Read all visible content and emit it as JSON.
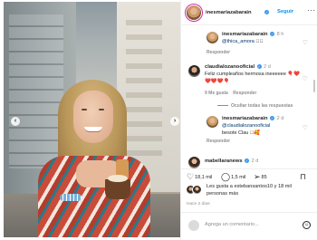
{
  "header": {
    "username": "inesmariazabarain",
    "follow_label": "Seguir",
    "more_label": "···"
  },
  "comments": [
    {
      "username": "inesmariazabarain",
      "time": "8 h",
      "mention": "@thica_amora",
      "emojis": "🏽🏽",
      "reply_label": "Responder"
    },
    {
      "username": "claudialozanooficial",
      "time": "2 d",
      "text": "Feliz cumpleaños hermosa ineeeeee",
      "emojis": "🎈❤️❤️❤️❤️🎈",
      "likes_label": "9 Me gusta",
      "reply_label": "Responder"
    },
    {
      "username": "inesmariazabarain",
      "time": "2 d",
      "mention": "@claudialozanooficial",
      "text": "besote Clau",
      "emojis": "🏽🥰",
      "reply_label": "Responder"
    },
    {
      "username": "mabellaranews",
      "time": "2 d"
    }
  ],
  "hide_replies_label": "Ocultar todas las respuestas",
  "actions": {
    "likes_count": "18,1 mil",
    "comments_count": "1,5 mil",
    "shares_count": "85"
  },
  "likes": {
    "text": "Les gusta a estebansantos10 y 18 mil personas más"
  },
  "posted_ago": "Hace 2 días",
  "add_comment": {
    "placeholder": "Agrega un comentario..."
  },
  "colors": {
    "accent": "#0095f6",
    "verified": "#3897f0",
    "muted": "#8e8e8e"
  },
  "icons": [
    "chevron-left-icon",
    "chevron-right-icon",
    "heart-icon",
    "comment-icon",
    "share-icon",
    "bookmark-icon",
    "emoji-icon",
    "verified-icon",
    "more-icon"
  ]
}
